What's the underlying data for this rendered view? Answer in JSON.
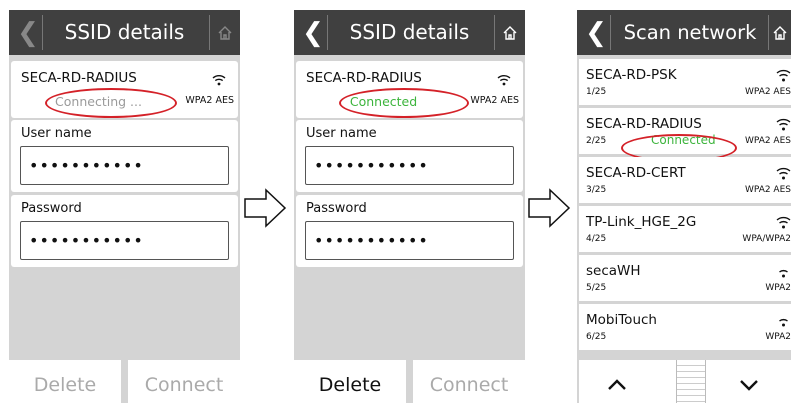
{
  "screens": [
    {
      "title": "SSID details",
      "ssid": {
        "name": "SECA-RD-RADIUS",
        "status": "Connecting ...",
        "security": "WPA2 AES"
      },
      "fields": [
        {
          "label": "User name",
          "value": "•••••••••••"
        },
        {
          "label": "Password",
          "value": "•••••••••••"
        }
      ],
      "buttons": {
        "delete": "Delete",
        "connect": "Connect"
      },
      "colors": {
        "status": "#9a9a9a"
      }
    },
    {
      "title": "SSID details",
      "ssid": {
        "name": "SECA-RD-RADIUS",
        "status": "Connected",
        "security": "WPA2 AES"
      },
      "fields": [
        {
          "label": "User name",
          "value": "•••••••••••"
        },
        {
          "label": "Password",
          "value": "•••••••••••"
        }
      ],
      "buttons": {
        "delete": "Delete",
        "connect": "Connect"
      },
      "colors": {
        "status": "#3cb43c"
      }
    },
    {
      "title": "Scan network",
      "networks": [
        {
          "name": "SECA-RD-PSK",
          "num": "1/25",
          "security": "WPA2 AES",
          "status": ""
        },
        {
          "name": "SECA-RD-RADIUS",
          "num": "2/25",
          "security": "WPA2 AES",
          "status": "Connected"
        },
        {
          "name": "SECA-RD-CERT",
          "num": "3/25",
          "security": "WPA2 AES",
          "status": ""
        },
        {
          "name": "TP-Link_HGE_2G",
          "num": "4/25",
          "security": "WPA/WPA2",
          "status": ""
        },
        {
          "name": "secaWH",
          "num": "5/25",
          "security": "WPA2",
          "status": ""
        },
        {
          "name": "MobiTouch",
          "num": "6/25",
          "security": "WPA2",
          "status": ""
        }
      ]
    }
  ],
  "icons": {
    "back": "chevron-left-icon",
    "home": "home-icon",
    "wifi": "wifi-icon",
    "arrow": "arrow-right-icon",
    "up": "chevron-up-icon",
    "down": "chevron-down-icon"
  },
  "colors": {
    "header": "#404040",
    "highlight_ring": "#d42128",
    "connected": "#3cb43c"
  }
}
